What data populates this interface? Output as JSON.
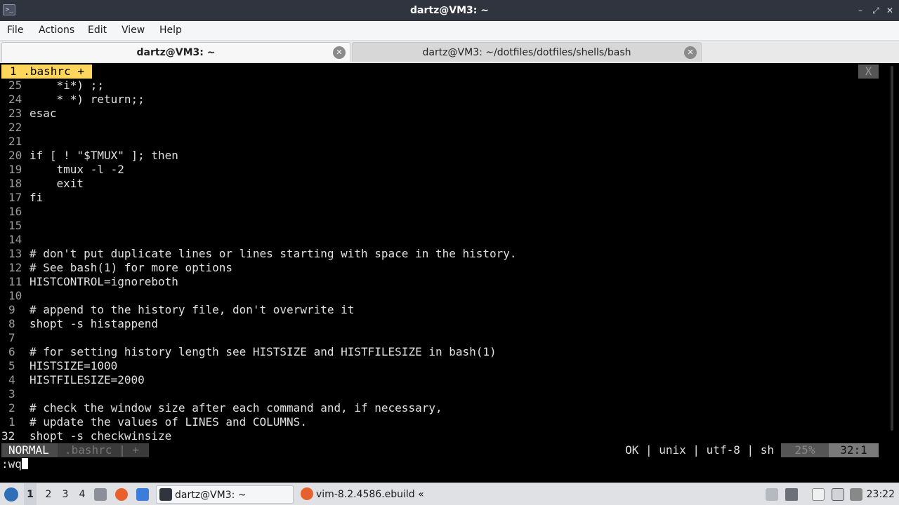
{
  "window": {
    "title": "dartz@VM3: ~",
    "minimize_icon": "minimize-icon",
    "restore_icon": "restore-icon",
    "close_icon": "close-icon"
  },
  "menubar": {
    "items": [
      "File",
      "Actions",
      "Edit",
      "View",
      "Help"
    ]
  },
  "tabs": [
    {
      "label": "dartz@VM3: ~",
      "active": true
    },
    {
      "label": "dartz@VM3: ~/dotfiles/dotfiles/shells/bash",
      "active": false
    }
  ],
  "vim": {
    "buffer_tab": "1 .bashrc +",
    "tab_close": "X",
    "lines": [
      {
        "num": "25",
        "text": "    *i*) ;;"
      },
      {
        "num": "24",
        "text": "    * *) return;;"
      },
      {
        "num": "23",
        "text": "esac"
      },
      {
        "num": "22",
        "text": ""
      },
      {
        "num": "21",
        "text": ""
      },
      {
        "num": "20",
        "text": "if [ ! \"$TMUX\" ]; then"
      },
      {
        "num": "19",
        "text": "    tmux -l -2"
      },
      {
        "num": "18",
        "text": "    exit"
      },
      {
        "num": "17",
        "text": "fi"
      },
      {
        "num": "16",
        "text": ""
      },
      {
        "num": "15",
        "text": ""
      },
      {
        "num": "14",
        "text": ""
      },
      {
        "num": "13",
        "text": "# don't put duplicate lines or lines starting with space in the history."
      },
      {
        "num": "12",
        "text": "# See bash(1) for more options"
      },
      {
        "num": "11",
        "text": "HISTCONTROL=ignoreboth"
      },
      {
        "num": "10",
        "text": ""
      },
      {
        "num": "9",
        "text": "# append to the history file, don't overwrite it"
      },
      {
        "num": "8",
        "text": "shopt -s histappend"
      },
      {
        "num": "7",
        "text": ""
      },
      {
        "num": "6",
        "text": "# for setting history length see HISTSIZE and HISTFILESIZE in bash(1)"
      },
      {
        "num": "5",
        "text": "HISTSIZE=1000"
      },
      {
        "num": "4",
        "text": "HISTFILESIZE=2000"
      },
      {
        "num": "3",
        "text": ""
      },
      {
        "num": "2",
        "text": "# check the window size after each command and, if necessary,"
      },
      {
        "num": "1",
        "text": "# update the values of LINES and COLUMNS."
      },
      {
        "num": "32",
        "text": "shopt -s checkwinsize",
        "current": true
      }
    ],
    "statusline": {
      "mode": "NORMAL",
      "file": ".bashrc | +",
      "info": "OK | unix | utf-8 | sh",
      "percent": "25%",
      "position": "32:1"
    },
    "cmdline": ":wq"
  },
  "taskbar": {
    "workspaces": [
      "1",
      "2",
      "3",
      "4"
    ],
    "active_workspace": "1",
    "launchers": [
      "file-manager-icon",
      "firefox-icon",
      "desktop-icon"
    ],
    "tasks": [
      {
        "label": "dartz@VM3: ~",
        "icon": "terminal-icon",
        "active": true
      },
      {
        "label": "vim-8.2.4586.ebuild « ...",
        "icon": "firefox-icon",
        "active": false
      }
    ],
    "tray": [
      "upload-icon",
      "volume-icon",
      "clipboard-icon",
      "display-icon",
      "network-icon"
    ],
    "clock": "23:22"
  },
  "colors": {
    "titlebar": "#2f343f",
    "vim_tab_accent": "#ffd65c",
    "terminal_bg": "#000000"
  }
}
